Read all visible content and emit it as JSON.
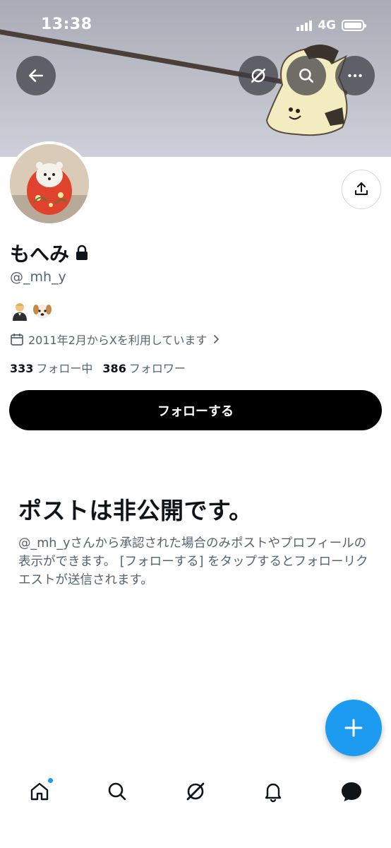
{
  "status_bar": {
    "time": "13:38",
    "network": "4G"
  },
  "profile": {
    "display_name": "もへみ",
    "handle": "@_mh_y",
    "bio_emojis": [
      "man-in-tuxedo-emoji",
      "dog-face-emoji"
    ],
    "joined": "2011年2月からXを利用しています",
    "following_count": "333",
    "following_label": "フォロー中",
    "followers_count": "386",
    "followers_label": "フォロワー",
    "follow_button_label": "フォローする"
  },
  "private_notice": {
    "title": "ポストは非公開です。",
    "description": "@_mh_yさんから承認された場合のみポストやプロフィールの表示ができます。 [フォローする] をタップするとフォローリクエストが送信されます。"
  },
  "icons": {
    "back": "back-arrow-icon",
    "grok": "grok-icon",
    "search": "search-icon",
    "more": "more-icon",
    "share": "share-icon",
    "compose": "plus-icon",
    "nav": [
      "home-icon",
      "search-icon",
      "grok-icon",
      "bell-icon",
      "messages-icon"
    ]
  },
  "colors": {
    "accent": "#1d9bf0",
    "text_primary": "#0f1419",
    "text_secondary": "#536471",
    "button_bg": "#000000"
  }
}
